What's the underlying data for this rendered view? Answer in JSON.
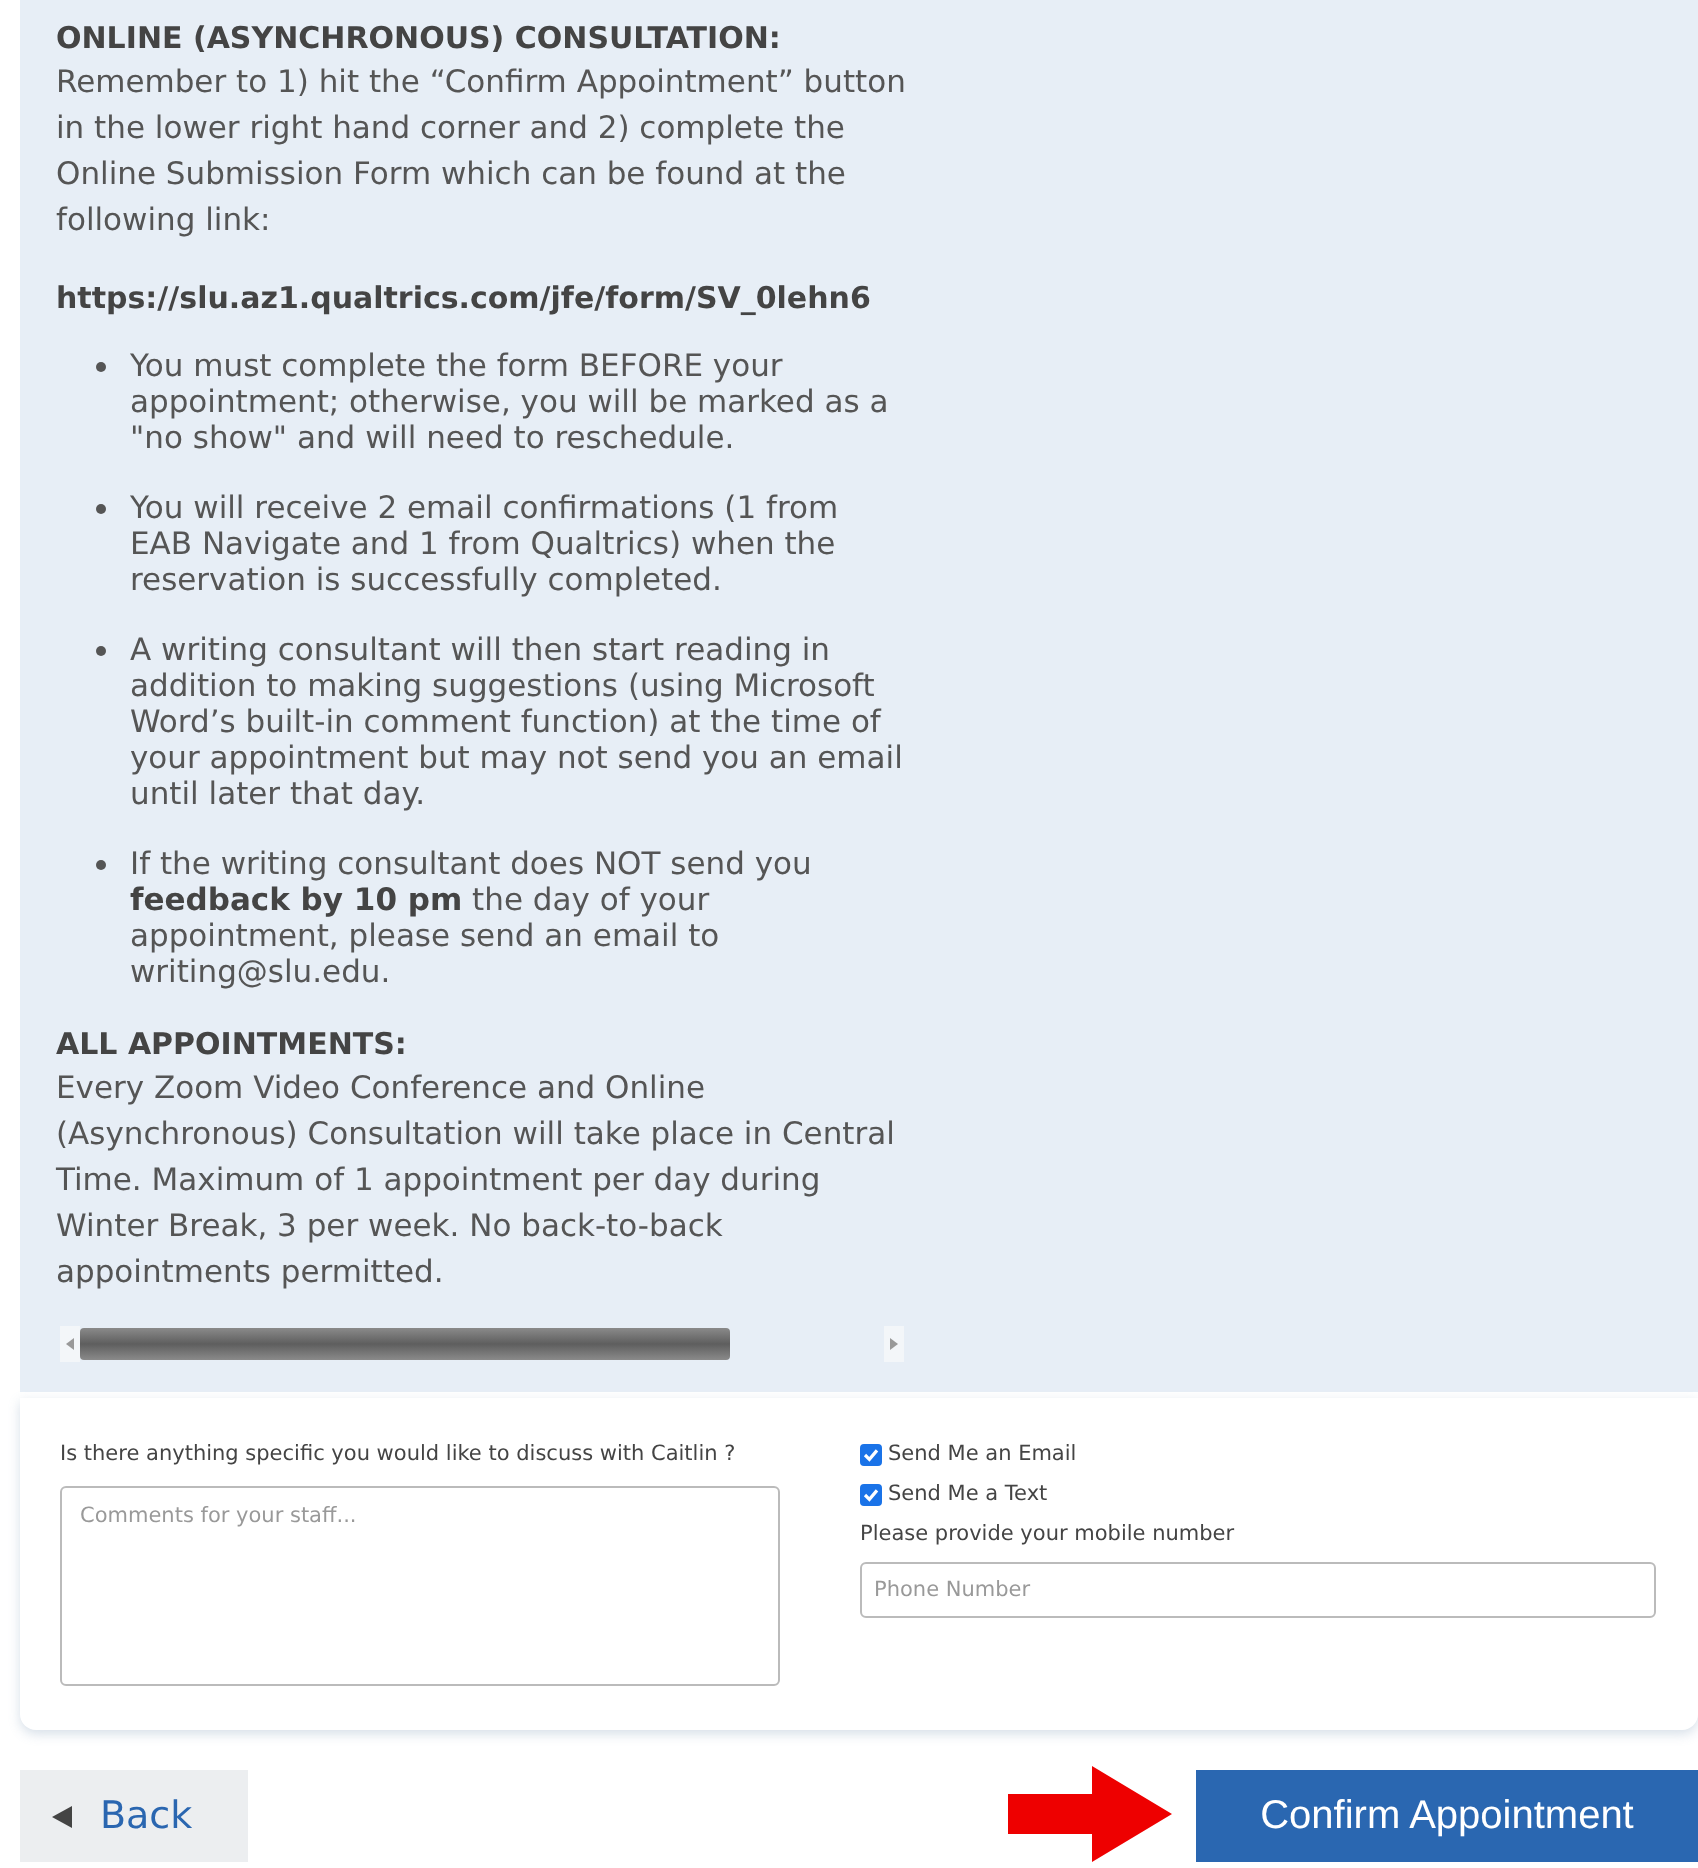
{
  "sections": [
    {
      "heading": "ONLINE (ASYNCHRONOUS) CONSULTATION:",
      "paragraph": "Remember to 1) hit the “Confirm Appointment” button in the lower right hand corner and 2) complete the Online Submission Form which can be found at the following link:",
      "link": "https://slu.az1.qualtrics.com/jfe/form/SV_0lehn6",
      "bullets": [
        "You must complete the form BEFORE your appointment; otherwise, you will be marked as a \"no show\" and will need to reschedule.",
        "You will receive 2 email confirmations (1 from EAB Navigate and 1 from Qualtrics) when the reservation is successfully completed.",
        "A writing consultant will then start reading in addition to making suggestions (using Microsoft Word’s built-in comment function) at the time of your appointment but may not send you an email until later that day.",
        "If the writing consultant does NOT send you **feedback by 10 pm** the day of your appointment, please send an email to writing@slu.edu."
      ]
    },
    {
      "heading": "ALL APPOINTMENTS:",
      "paragraph": "Every Zoom Video Conference and Online (Asynchronous) Consultation will take place in Central Time. Maximum of 1 appointment per day during Winter Break, 3 per week. No back-to-back appointments permitted."
    }
  ],
  "form": {
    "question": "Is there anything specific you would like to discuss with Caitlin ?",
    "comments": {
      "placeholder": "Comments for your staff..."
    },
    "options": [
      {
        "label": "Send Me an Email",
        "checked": true
      },
      {
        "label": "Send Me a Text",
        "checked": true
      }
    ],
    "mobile_label": "Please provide your mobile number",
    "phone": {
      "placeholder": "Phone Number"
    }
  },
  "buttons": {
    "back": "Back",
    "confirm": "Confirm Appointment"
  }
}
